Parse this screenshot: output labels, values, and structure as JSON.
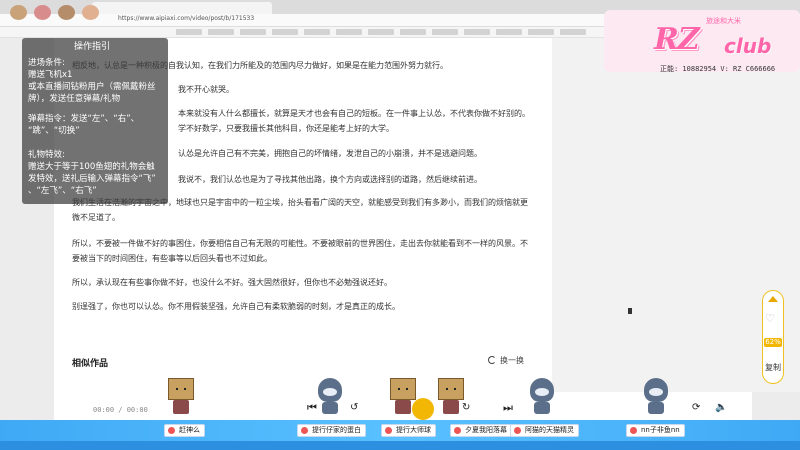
{
  "browser": {
    "url": "https://www.aipiaxi.com/video/post/b/171533"
  },
  "overlay": {
    "title": "操作指引",
    "lines": [
      "进场条件:",
      "赠送飞机x1",
      "或本直播间钻粉用户（需佩戴粉丝",
      "牌），发送任意弹幕/礼物",
      "弹幕指令：发送“左”、“右”、",
      "“跳”、“切换”",
      "礼物特效:",
      "赠送大于等于100鱼翅的礼物会触",
      "发特效，送礼后输入弹幕指令“飞”",
      "、“左飞”、“右飞”"
    ]
  },
  "logo": {
    "small": "旅途和大米",
    "brand_rz": "RZ",
    "brand_club": "club",
    "stat": "正能: 10882954   V: RZ C666666"
  },
  "article": {
    "paragraphs": [
      "相反地，认总是一种积极的自我认知，在我们力所能及的范围内尽力做好，如果是在能力范围外努力就行。",
      "我不开心就哭。",
      "本来就没有人什么都擅长，就算是天才也会有自己的短板。在一件事上认怂，不代表你做不好别的。学不好数学，只要我擅长其他科目，你还是能考上好的大学。",
      "认怂是允许自己有不完美，拥抱自己的坏情绪，发泄自己的小崩溃，并不是逃避问题。",
      "我说不，我们认怂也是为了寻找其他出路，换个方向或选择别的道路，然后继续前进。",
      "我们生活在浩瀚的宇宙之中，地球也只是宇宙中的一粒尘埃，抬头看看广阔的天空，就能感受到我们有多渺小，而我们的烦恼就更微不足道了。",
      "所以，不要被一件做不好的事困住，你要相信自己有无限的可能性。不要被眼前的世界困住，走出去你就能看到不一样的风景。不要被当下的时间困住，有些事等以后回头看也不过如此。",
      "所以，承认现在有些事你做不好，也没什么不好。强大固然很好，但你也不必勉强说还好。",
      "别逞强了，你也可以认怂。你不用假装坚强，允许自己有柔软脆弱的时刻，才是真正的成长。"
    ],
    "similar_title": "相似作品",
    "refresh_label": "换一换"
  },
  "player": {
    "time": "00:00 / 00:00"
  },
  "side": {
    "percent": "62%",
    "copy_label": "复制"
  },
  "bottom_tags": [
    "赶神么",
    "提行仔家的蛋白",
    "提行大师球",
    "夕夏我阳落幕",
    "阿猫的天猫精灵",
    "nn子非鱼nn"
  ],
  "colors": {
    "accent": "#f2b705",
    "bottom_bar": "#3fa9f5",
    "logo_pink": "#ff66aa"
  }
}
